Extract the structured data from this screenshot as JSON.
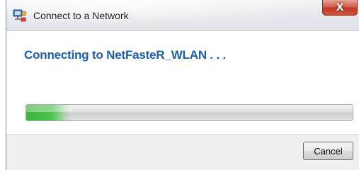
{
  "window": {
    "title": "Connect to a Network",
    "icon": "network-wizard-icon",
    "close_label": "X"
  },
  "main": {
    "heading": "Connecting to NetFasteR_WLAN . . ."
  },
  "progress": {
    "percent": 14,
    "color": "#4cc44c"
  },
  "footer": {
    "cancel_label": "Cancel"
  },
  "colors": {
    "heading": "#1f5dab",
    "close_button": "#c3361f"
  }
}
